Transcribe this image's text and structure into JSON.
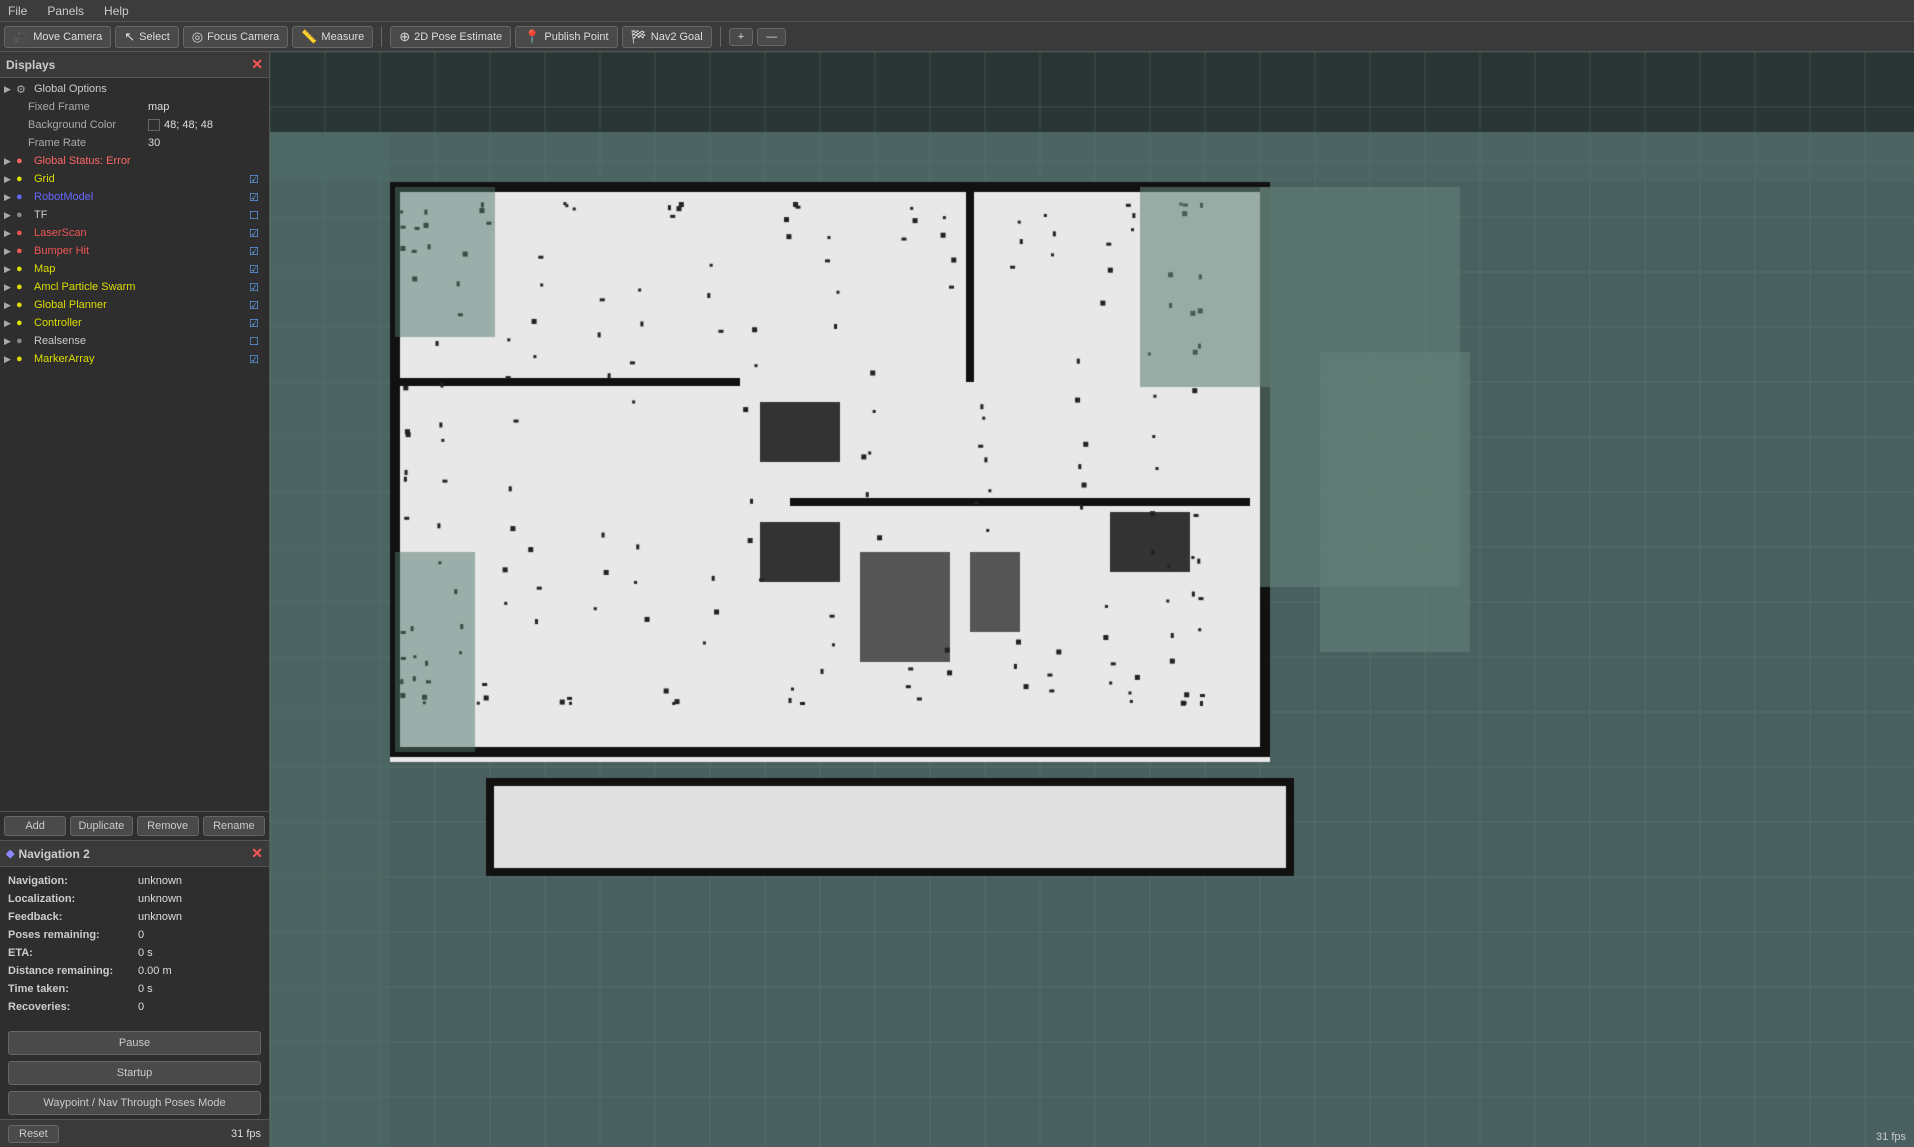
{
  "menubar": {
    "items": [
      "File",
      "Panels",
      "Help"
    ]
  },
  "toolbar": {
    "buttons": [
      {
        "id": "move-camera",
        "icon": "🎥",
        "label": "Move Camera"
      },
      {
        "id": "select",
        "icon": "↖",
        "label": "Select"
      },
      {
        "id": "focus-camera",
        "icon": "◎",
        "label": "Focus Camera"
      },
      {
        "id": "measure",
        "icon": "📏",
        "label": "Measure"
      },
      {
        "id": "2d-pose-estimate",
        "icon": "⊕",
        "label": "2D Pose Estimate"
      },
      {
        "id": "publish-point",
        "icon": "📍",
        "label": "Publish Point"
      },
      {
        "id": "nav2-goal",
        "icon": "🏁",
        "label": "Nav2 Goal"
      }
    ],
    "extras": [
      "+",
      "—"
    ]
  },
  "displays": {
    "title": "Displays",
    "global_options": {
      "label": "Global Options",
      "fixed_frame_label": "Fixed Frame",
      "fixed_frame_value": "map",
      "bg_color_label": "Background Color",
      "bg_color_value": "48; 48; 48",
      "frame_rate_label": "Frame Rate",
      "frame_rate_value": "30"
    },
    "items": [
      {
        "id": "global-status",
        "icon": "🔴",
        "label": "Global Status: Error",
        "arrow": "▶",
        "checked": null,
        "color": "error"
      },
      {
        "id": "grid",
        "icon": "🟡",
        "label": "Grid",
        "arrow": "▶",
        "checked": true,
        "color": "warn"
      },
      {
        "id": "robot-model",
        "icon": "🔵",
        "label": "RobotModel",
        "arrow": "▶",
        "checked": true,
        "color": "blue"
      },
      {
        "id": "tf",
        "icon": "⚪",
        "label": "TF",
        "arrow": "▶",
        "checked": false,
        "color": "normal"
      },
      {
        "id": "laser-scan",
        "icon": "🔴",
        "label": "LaserScan",
        "arrow": "▶",
        "checked": true,
        "color": "error"
      },
      {
        "id": "bumper-hit",
        "icon": "🔴",
        "label": "Bumper Hit",
        "arrow": "▶",
        "checked": true,
        "color": "error"
      },
      {
        "id": "map",
        "icon": "🟡",
        "label": "Map",
        "arrow": "▶",
        "checked": true,
        "color": "warn"
      },
      {
        "id": "amcl-particle-swarm",
        "icon": "🟡",
        "label": "Amcl Particle Swarm",
        "arrow": "▶",
        "checked": true,
        "color": "warn"
      },
      {
        "id": "global-planner",
        "icon": "🟡",
        "label": "Global Planner",
        "arrow": "▶",
        "checked": true,
        "color": "warn"
      },
      {
        "id": "controller",
        "icon": "🟡",
        "label": "Controller",
        "arrow": "▶",
        "checked": true,
        "color": "warn"
      },
      {
        "id": "realsense",
        "icon": "⚪",
        "label": "Realsense",
        "arrow": "▶",
        "checked": false,
        "color": "normal"
      },
      {
        "id": "marker-array",
        "icon": "🟡",
        "label": "MarkerArray",
        "arrow": "▶",
        "checked": true,
        "color": "warn"
      }
    ],
    "buttons": [
      "Add",
      "Duplicate",
      "Remove",
      "Rename"
    ]
  },
  "navigation2": {
    "title": "Navigation 2",
    "icon": "◆",
    "fields": [
      {
        "label": "Navigation:",
        "value": "unknown"
      },
      {
        "label": "Localization:",
        "value": "unknown"
      },
      {
        "label": "Feedback:",
        "value": "unknown"
      },
      {
        "label": "Poses remaining:",
        "value": "0"
      },
      {
        "label": "ETA:",
        "value": "0 s"
      },
      {
        "label": "Distance remaining:",
        "value": "0.00 m"
      },
      {
        "label": "Time taken:",
        "value": "0 s"
      },
      {
        "label": "Recoveries:",
        "value": "0"
      }
    ],
    "buttons": [
      "Pause",
      "Startup",
      "Waypoint / Nav Through Poses Mode"
    ]
  },
  "reset_label": "Reset",
  "fps_display": "31 fps",
  "cursor_label": "31 fps"
}
